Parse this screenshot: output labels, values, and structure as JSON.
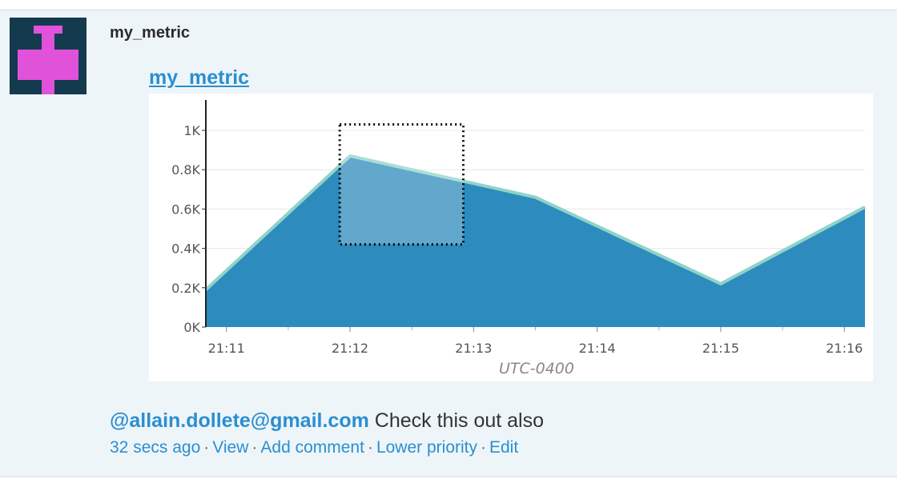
{
  "post": {
    "author": "my_metric",
    "metric_title": "my_metric",
    "comment": {
      "mention": "@allain.dollete@gmail.com",
      "text": "Check this out also"
    },
    "meta": {
      "time": "32 secs ago",
      "actions": [
        "View",
        "Add comment",
        "Lower priority",
        "Edit"
      ]
    }
  },
  "colors": {
    "accent": "#2a8fd0",
    "area_fill": "#2e8bbd",
    "area_line": "#8fd3c9",
    "avatar_bg": "#133a4f",
    "avatar_icon": "#e052d9"
  },
  "icons": {
    "avatar": "pink-cross-identicon"
  },
  "chart_data": {
    "type": "area",
    "x": [
      "21:10:50",
      "21:12:00",
      "21:13:30",
      "21:15:00",
      "21:16:10"
    ],
    "values": [
      190,
      870,
      660,
      220,
      610
    ],
    "x_ticks": [
      "21:11",
      "21:12",
      "21:13",
      "21:14",
      "21:15",
      "21:16"
    ],
    "y_ticks": [
      "0K",
      "0.2K",
      "0.4K",
      "0.6K",
      "0.8K",
      "1K"
    ],
    "ylim": [
      0,
      1000
    ],
    "xlabel": "UTC-0400",
    "ylabel": "",
    "title": "",
    "grid": true,
    "selection": {
      "x_start": "21:11:55",
      "x_end": "21:12:55",
      "y_start": 420,
      "y_end": 1030
    }
  }
}
